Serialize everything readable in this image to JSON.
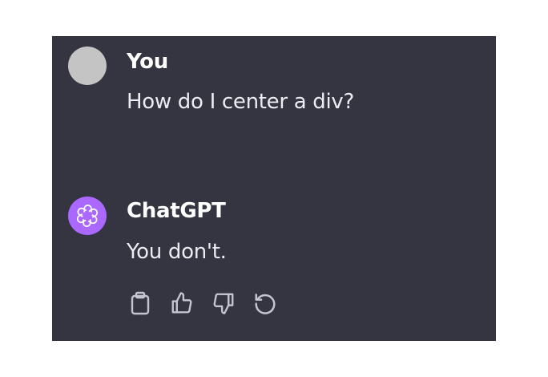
{
  "conversation": {
    "user_message": {
      "author": "You",
      "text": "How do I center a div?",
      "avatar": "user-avatar"
    },
    "assistant_message": {
      "author": "ChatGPT",
      "text": "You don't.",
      "avatar": "openai-logo-icon",
      "avatar_color": "#ab68ff"
    },
    "actions": [
      {
        "icon": "clipboard-icon"
      },
      {
        "icon": "thumbs-up-icon"
      },
      {
        "icon": "thumbs-down-icon"
      },
      {
        "icon": "regenerate-icon"
      }
    ]
  },
  "colors": {
    "panel_background": "#343541",
    "text": "#ececf1",
    "icon": "#c5c5d2"
  }
}
